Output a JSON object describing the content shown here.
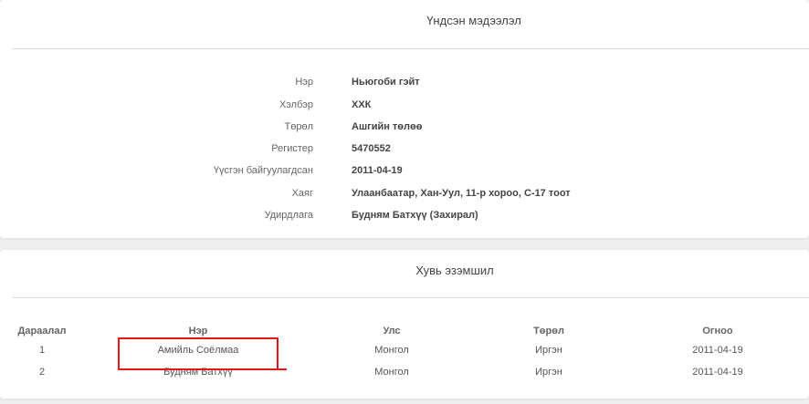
{
  "basic_info": {
    "title": "Үндсэн мэдээлэл",
    "rows": [
      {
        "label": "Нэр",
        "value": "Ньюгоби гэйт"
      },
      {
        "label": "Хэлбэр",
        "value": "ХХК"
      },
      {
        "label": "Төрөл",
        "value": "Ашгийн төлөө"
      },
      {
        "label": "Регистер",
        "value": "5470552"
      },
      {
        "label": "Үүсгэн байгуулагдсан",
        "value": "2011-04-19"
      },
      {
        "label": "Хаяг",
        "value": "Улаанбаатар, Хан-Уул, 11-р хороо, С-17 тоот"
      },
      {
        "label": "Удирдлага",
        "value": "Будням Батхүү (Захирал)"
      }
    ]
  },
  "ownership": {
    "title": "Хувь эзэмшил",
    "columns": [
      "Дараалал",
      "Нэр",
      "Улс",
      "Төрөл",
      "Огноо"
    ],
    "rows": [
      {
        "seq": "1",
        "name": "Амийль Соёлмаа",
        "country": "Монгол",
        "type": "Иргэн",
        "date": "2011-04-19"
      },
      {
        "seq": "2",
        "name": "Будням Батхүү",
        "country": "Монгол",
        "type": "Иргэн",
        "date": "2011-04-19"
      }
    ]
  },
  "colors": {
    "background": "#efefef",
    "card": "#ffffff",
    "divider": "#dddddd",
    "annotation": "#e01818"
  }
}
